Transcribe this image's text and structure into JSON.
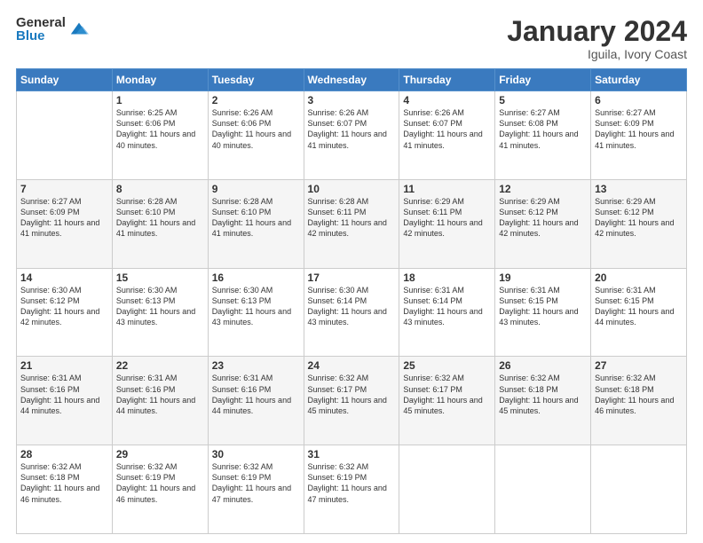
{
  "logo": {
    "general": "General",
    "blue": "Blue"
  },
  "header": {
    "title": "January 2024",
    "subtitle": "Iguila, Ivory Coast"
  },
  "days_of_week": [
    "Sunday",
    "Monday",
    "Tuesday",
    "Wednesday",
    "Thursday",
    "Friday",
    "Saturday"
  ],
  "weeks": [
    [
      {
        "day": "",
        "sunrise": "",
        "sunset": "",
        "daylight": ""
      },
      {
        "day": "1",
        "sunrise": "Sunrise: 6:25 AM",
        "sunset": "Sunset: 6:06 PM",
        "daylight": "Daylight: 11 hours and 40 minutes."
      },
      {
        "day": "2",
        "sunrise": "Sunrise: 6:26 AM",
        "sunset": "Sunset: 6:06 PM",
        "daylight": "Daylight: 11 hours and 40 minutes."
      },
      {
        "day": "3",
        "sunrise": "Sunrise: 6:26 AM",
        "sunset": "Sunset: 6:07 PM",
        "daylight": "Daylight: 11 hours and 41 minutes."
      },
      {
        "day": "4",
        "sunrise": "Sunrise: 6:26 AM",
        "sunset": "Sunset: 6:07 PM",
        "daylight": "Daylight: 11 hours and 41 minutes."
      },
      {
        "day": "5",
        "sunrise": "Sunrise: 6:27 AM",
        "sunset": "Sunset: 6:08 PM",
        "daylight": "Daylight: 11 hours and 41 minutes."
      },
      {
        "day": "6",
        "sunrise": "Sunrise: 6:27 AM",
        "sunset": "Sunset: 6:09 PM",
        "daylight": "Daylight: 11 hours and 41 minutes."
      }
    ],
    [
      {
        "day": "7",
        "sunrise": "Sunrise: 6:27 AM",
        "sunset": "Sunset: 6:09 PM",
        "daylight": "Daylight: 11 hours and 41 minutes."
      },
      {
        "day": "8",
        "sunrise": "Sunrise: 6:28 AM",
        "sunset": "Sunset: 6:10 PM",
        "daylight": "Daylight: 11 hours and 41 minutes."
      },
      {
        "day": "9",
        "sunrise": "Sunrise: 6:28 AM",
        "sunset": "Sunset: 6:10 PM",
        "daylight": "Daylight: 11 hours and 41 minutes."
      },
      {
        "day": "10",
        "sunrise": "Sunrise: 6:28 AM",
        "sunset": "Sunset: 6:11 PM",
        "daylight": "Daylight: 11 hours and 42 minutes."
      },
      {
        "day": "11",
        "sunrise": "Sunrise: 6:29 AM",
        "sunset": "Sunset: 6:11 PM",
        "daylight": "Daylight: 11 hours and 42 minutes."
      },
      {
        "day": "12",
        "sunrise": "Sunrise: 6:29 AM",
        "sunset": "Sunset: 6:12 PM",
        "daylight": "Daylight: 11 hours and 42 minutes."
      },
      {
        "day": "13",
        "sunrise": "Sunrise: 6:29 AM",
        "sunset": "Sunset: 6:12 PM",
        "daylight": "Daylight: 11 hours and 42 minutes."
      }
    ],
    [
      {
        "day": "14",
        "sunrise": "Sunrise: 6:30 AM",
        "sunset": "Sunset: 6:12 PM",
        "daylight": "Daylight: 11 hours and 42 minutes."
      },
      {
        "day": "15",
        "sunrise": "Sunrise: 6:30 AM",
        "sunset": "Sunset: 6:13 PM",
        "daylight": "Daylight: 11 hours and 43 minutes."
      },
      {
        "day": "16",
        "sunrise": "Sunrise: 6:30 AM",
        "sunset": "Sunset: 6:13 PM",
        "daylight": "Daylight: 11 hours and 43 minutes."
      },
      {
        "day": "17",
        "sunrise": "Sunrise: 6:30 AM",
        "sunset": "Sunset: 6:14 PM",
        "daylight": "Daylight: 11 hours and 43 minutes."
      },
      {
        "day": "18",
        "sunrise": "Sunrise: 6:31 AM",
        "sunset": "Sunset: 6:14 PM",
        "daylight": "Daylight: 11 hours and 43 minutes."
      },
      {
        "day": "19",
        "sunrise": "Sunrise: 6:31 AM",
        "sunset": "Sunset: 6:15 PM",
        "daylight": "Daylight: 11 hours and 43 minutes."
      },
      {
        "day": "20",
        "sunrise": "Sunrise: 6:31 AM",
        "sunset": "Sunset: 6:15 PM",
        "daylight": "Daylight: 11 hours and 44 minutes."
      }
    ],
    [
      {
        "day": "21",
        "sunrise": "Sunrise: 6:31 AM",
        "sunset": "Sunset: 6:16 PM",
        "daylight": "Daylight: 11 hours and 44 minutes."
      },
      {
        "day": "22",
        "sunrise": "Sunrise: 6:31 AM",
        "sunset": "Sunset: 6:16 PM",
        "daylight": "Daylight: 11 hours and 44 minutes."
      },
      {
        "day": "23",
        "sunrise": "Sunrise: 6:31 AM",
        "sunset": "Sunset: 6:16 PM",
        "daylight": "Daylight: 11 hours and 44 minutes."
      },
      {
        "day": "24",
        "sunrise": "Sunrise: 6:32 AM",
        "sunset": "Sunset: 6:17 PM",
        "daylight": "Daylight: 11 hours and 45 minutes."
      },
      {
        "day": "25",
        "sunrise": "Sunrise: 6:32 AM",
        "sunset": "Sunset: 6:17 PM",
        "daylight": "Daylight: 11 hours and 45 minutes."
      },
      {
        "day": "26",
        "sunrise": "Sunrise: 6:32 AM",
        "sunset": "Sunset: 6:18 PM",
        "daylight": "Daylight: 11 hours and 45 minutes."
      },
      {
        "day": "27",
        "sunrise": "Sunrise: 6:32 AM",
        "sunset": "Sunset: 6:18 PM",
        "daylight": "Daylight: 11 hours and 46 minutes."
      }
    ],
    [
      {
        "day": "28",
        "sunrise": "Sunrise: 6:32 AM",
        "sunset": "Sunset: 6:18 PM",
        "daylight": "Daylight: 11 hours and 46 minutes."
      },
      {
        "day": "29",
        "sunrise": "Sunrise: 6:32 AM",
        "sunset": "Sunset: 6:19 PM",
        "daylight": "Daylight: 11 hours and 46 minutes."
      },
      {
        "day": "30",
        "sunrise": "Sunrise: 6:32 AM",
        "sunset": "Sunset: 6:19 PM",
        "daylight": "Daylight: 11 hours and 47 minutes."
      },
      {
        "day": "31",
        "sunrise": "Sunrise: 6:32 AM",
        "sunset": "Sunset: 6:19 PM",
        "daylight": "Daylight: 11 hours and 47 minutes."
      },
      {
        "day": "",
        "sunrise": "",
        "sunset": "",
        "daylight": ""
      },
      {
        "day": "",
        "sunrise": "",
        "sunset": "",
        "daylight": ""
      },
      {
        "day": "",
        "sunrise": "",
        "sunset": "",
        "daylight": ""
      }
    ]
  ]
}
